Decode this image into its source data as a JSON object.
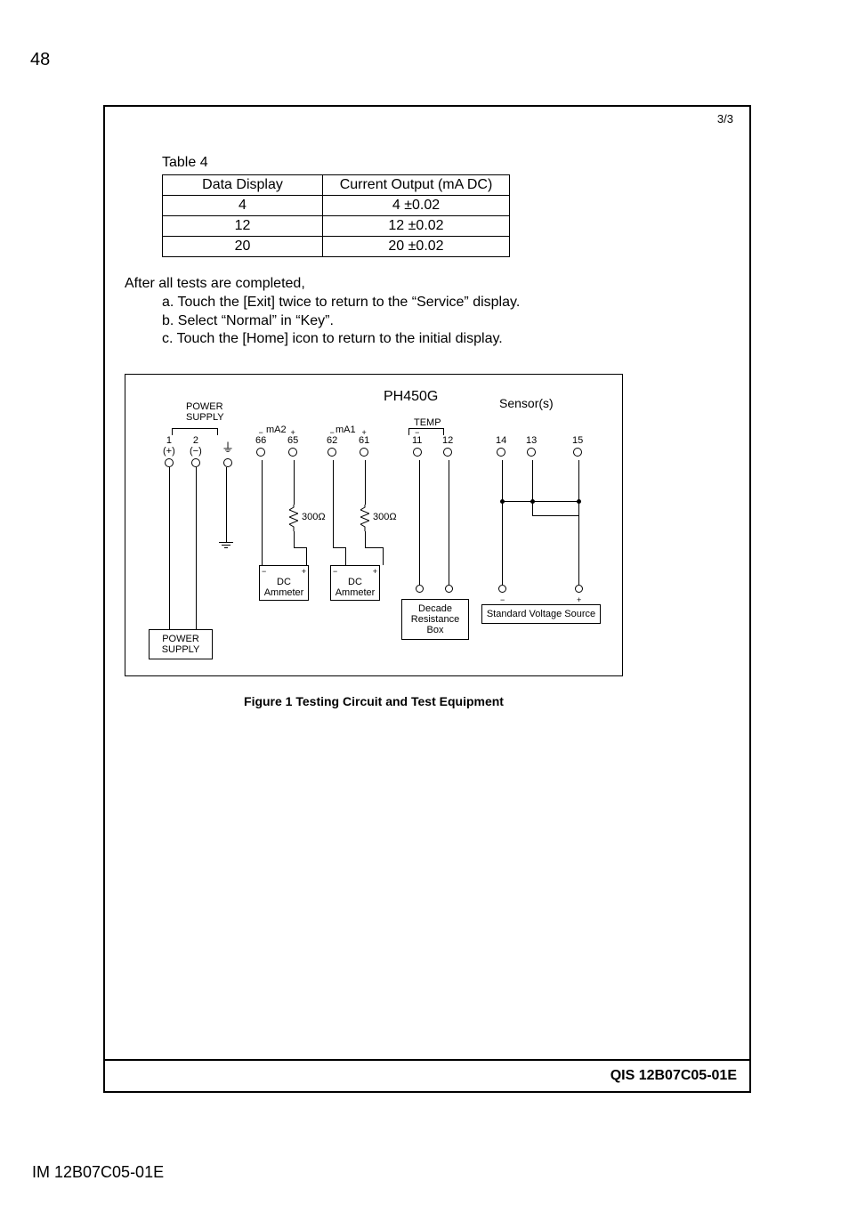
{
  "page_number_top": "48",
  "frame": {
    "page_of": "3/3",
    "table": {
      "caption": "Table 4",
      "headers": [
        "Data Display",
        "Current Output (mA DC)"
      ],
      "rows": [
        {
          "display": "4",
          "output": "4 ±0.02"
        },
        {
          "display": "12",
          "output": "12 ±0.02"
        },
        {
          "display": "20",
          "output": "20 ±0.02"
        }
      ]
    },
    "after": {
      "intro": "After all tests are completed,",
      "items": [
        "a.   Touch the [Exit] twice to return to the “Service” display.",
        "b.   Select “Normal” in “Key”.",
        "c.   Touch the [Home] icon to return to the initial display."
      ]
    },
    "figure": {
      "title": "PH450G",
      "sensor_label": "Sensor(s)",
      "power_supply_label": "POWER\nSUPPLY",
      "temp_label": "TEMP",
      "mA2": "mA2",
      "mA1": "mA1",
      "terminals": {
        "t1": {
          "sign": "",
          "num": "1",
          "paren": "(+)"
        },
        "t2": {
          "sign": "",
          "num": "2",
          "paren": "(−)"
        },
        "gnd": {
          "glyph": "⏚"
        },
        "t66": {
          "sign": "−",
          "num": "66"
        },
        "t65": {
          "sign": "+",
          "num": "65"
        },
        "t62": {
          "sign": "−",
          "num": "62"
        },
        "t61": {
          "sign": "+",
          "num": "61"
        },
        "t11": {
          "sign": "−",
          "num": "11"
        },
        "t12": {
          "sign": "",
          "num": "12"
        },
        "t14": {
          "sign": "",
          "num": "14"
        },
        "t13": {
          "sign": "",
          "num": "13"
        },
        "t15": {
          "sign": "",
          "num": "15"
        }
      },
      "resistor_value": "300Ω",
      "ammeter_label": "DC\nAmmeter",
      "ammeter_minus": "−",
      "ammeter_plus": "+",
      "decade_box": "Decade\nResistance\nBox",
      "voltage_source": "Standard Voltage Source",
      "voltage_minus": "−",
      "voltage_plus": "+",
      "lower_power_supply": "POWER\nSUPPLY",
      "caption": "Figure 1 Testing Circuit and Test Equipment"
    },
    "footer_code": "QIS  12B07C05-01E"
  },
  "doc_id_bottom": "IM 12B07C05-01E"
}
